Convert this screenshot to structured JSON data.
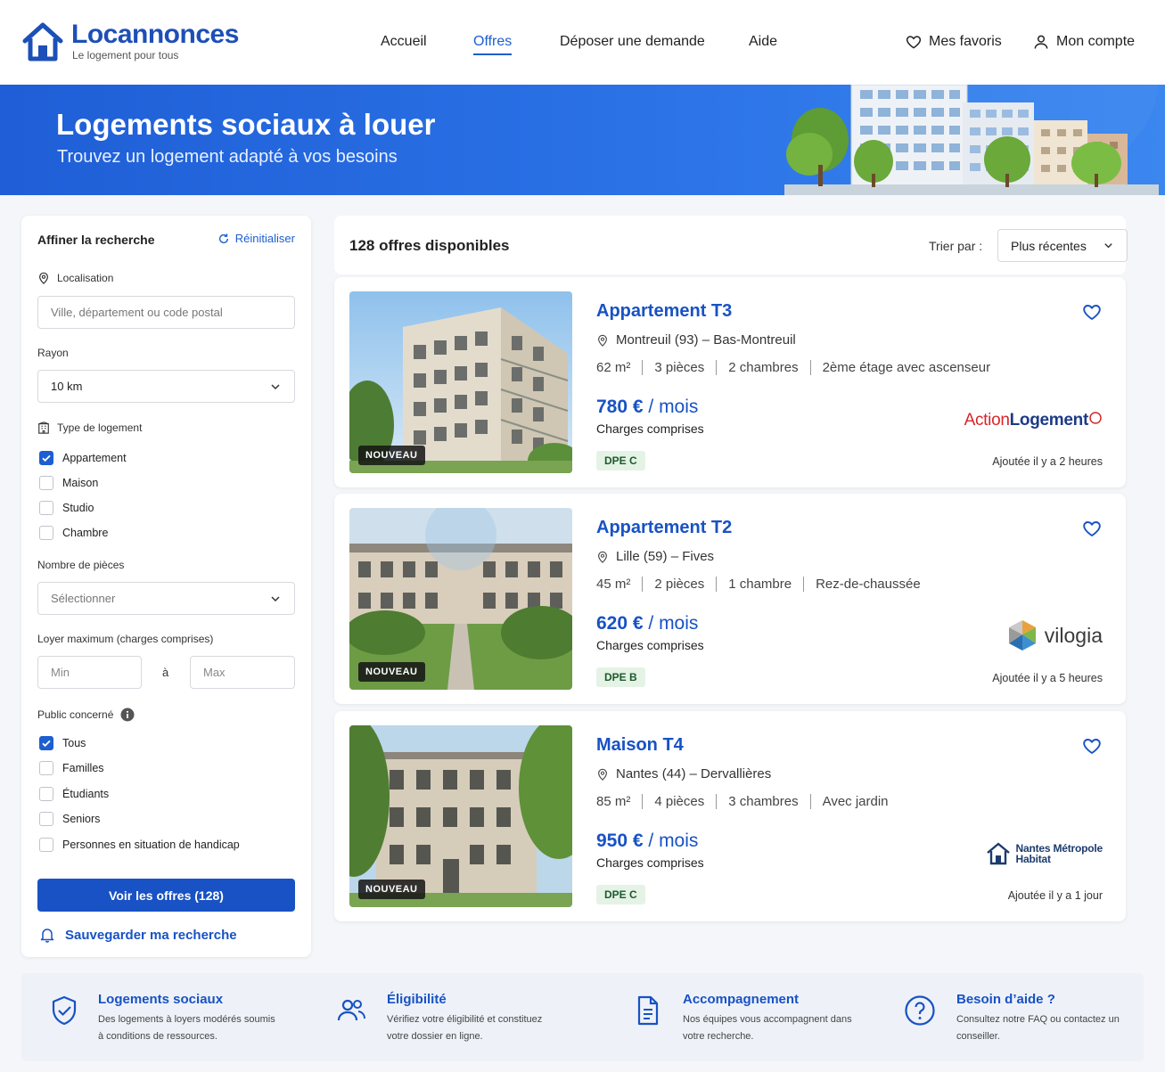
{
  "brand": {
    "name": "Locannonces",
    "tagline": "Le logement pour tous",
    "primary_color": "#1852c4",
    "accent_color": "#1d5fd0"
  },
  "nav": {
    "items": [
      {
        "label": "Accueil",
        "active": false
      },
      {
        "label": "Offres",
        "active": true
      },
      {
        "label": "Déposer une demande",
        "active": false
      },
      {
        "label": "Aide",
        "active": false
      }
    ],
    "favorites_label": "Mes favoris",
    "account_label": "Mon compte"
  },
  "banner": {
    "title": "Logements sociaux à louer",
    "subtitle": "Trouvez un logement adapté à vos besoins"
  },
  "filters": {
    "title": "Affiner la recherche",
    "reset_label": "Réinitialiser",
    "location_label": "Localisation",
    "location_placeholder": "Ville, département ou code postal",
    "radius_label": "Rayon",
    "radius_value": "10 km",
    "housing_type_label": "Type de logement",
    "housing_types": [
      {
        "label": "Appartement",
        "checked": true
      },
      {
        "label": "Maison",
        "checked": false
      },
      {
        "label": "Studio",
        "checked": false
      },
      {
        "label": "Chambre",
        "checked": false
      }
    ],
    "rooms_label": "Nombre de pièces",
    "rooms_placeholder": "Sélectionner",
    "rent_label": "Loyer maximum (charges comprises)",
    "rent_min_placeholder": "Min",
    "rent_separator": "à",
    "rent_max_placeholder": "Max",
    "public_label": "Public concerné",
    "publics": [
      {
        "label": "Tous",
        "checked": true
      },
      {
        "label": "Familles",
        "checked": false
      },
      {
        "label": "Étudiants",
        "checked": false
      },
      {
        "label": "Seniors",
        "checked": false
      },
      {
        "label": "Personnes en situation de handicap",
        "checked": false
      }
    ],
    "submit_label": "Voir les offres (128)",
    "save_label": "Sauvegarder ma recherche"
  },
  "results": {
    "count_label": "128 offres disponibles",
    "sort_label": "Trier par :",
    "sort_value": "Plus récentes"
  },
  "listings": [
    {
      "title": "Appartement T3",
      "location": "Montreuil (93) – Bas-Montreuil",
      "area": "62 m²",
      "rooms": "3 pièces",
      "bedrooms": "2 chambres",
      "extra_sup": "2ème",
      "extra": "étage avec ascenseur",
      "price": "780 €",
      "period": " / mois",
      "charges": "Charges comprises",
      "dpe": "DPE C",
      "badge": "NOUVEAU",
      "added": "Ajoutée il y a 2 heures",
      "provider_part1": "Action",
      "provider_part2": "Logement"
    },
    {
      "title": "Appartement T2",
      "location": "Lille (59) – Fives",
      "area": "45 m²",
      "rooms": "2 pièces",
      "bedrooms": "1 chambre",
      "extra": "Rez-de-chaussée",
      "price": "620 €",
      "period": " / mois",
      "charges": "Charges comprises",
      "dpe": "DPE B",
      "badge": "NOUVEAU",
      "added": "Ajoutée il y a 5 heures",
      "provider": "vilogia"
    },
    {
      "title": "Maison T4",
      "location": "Nantes (44) – Dervallières",
      "area": "85 m²",
      "rooms": "4 pièces",
      "bedrooms": "3 chambres",
      "extra": "Avec jardin",
      "price": "950 €",
      "period": " / mois",
      "charges": "Charges comprises",
      "dpe": "DPE C",
      "badge": "NOUVEAU",
      "added": "Ajoutée il y a 1 jour",
      "provider_line1": "Nantes Métropole",
      "provider_line2": "Habitat"
    }
  ],
  "features": [
    {
      "title": "Logements sociaux",
      "desc": "Des logements à loyers modérés soumis à conditions de ressources.",
      "icon": "shield-check-icon"
    },
    {
      "title": "Éligibilité",
      "desc": "Vérifiez votre éligibilité et constituez votre dossier en ligne.",
      "icon": "users-icon"
    },
    {
      "title": "Accompagnement",
      "desc": "Nos équipes vous accompagnent dans votre recherche.",
      "icon": "document-icon"
    },
    {
      "title": "Besoin d’aide ?",
      "desc": "Consultez notre FAQ ou contactez un conseiller.",
      "icon": "question-circle-icon"
    }
  ]
}
